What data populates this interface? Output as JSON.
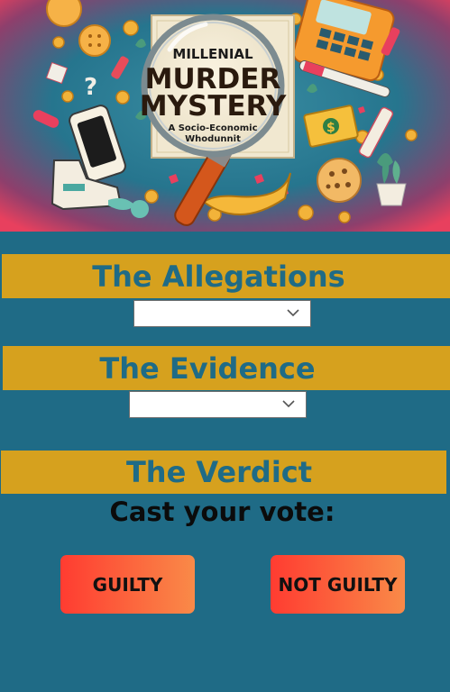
{
  "hero": {
    "poster_line1": "MILLENIAL",
    "poster_line2": "MURDER",
    "poster_line3": "MYSTERY",
    "poster_line4": "A Socio-Economic",
    "poster_line5": "Whodunnit",
    "colors": {
      "teal": "#1f6b86",
      "pink": "#e8405e",
      "gold": "#d6a11e"
    }
  },
  "sections": {
    "allegations": "The Allegations",
    "evidence": "The Evidence",
    "verdict": "The Verdict"
  },
  "allegations_select": {
    "value": "",
    "icon": "chevron-down-icon"
  },
  "evidence_select": {
    "value": "",
    "icon": "chevron-down-icon"
  },
  "vote": {
    "prompt": "Cast your vote:",
    "guilty": "GUILTY",
    "not_guilty": "NOT GUILTY"
  }
}
